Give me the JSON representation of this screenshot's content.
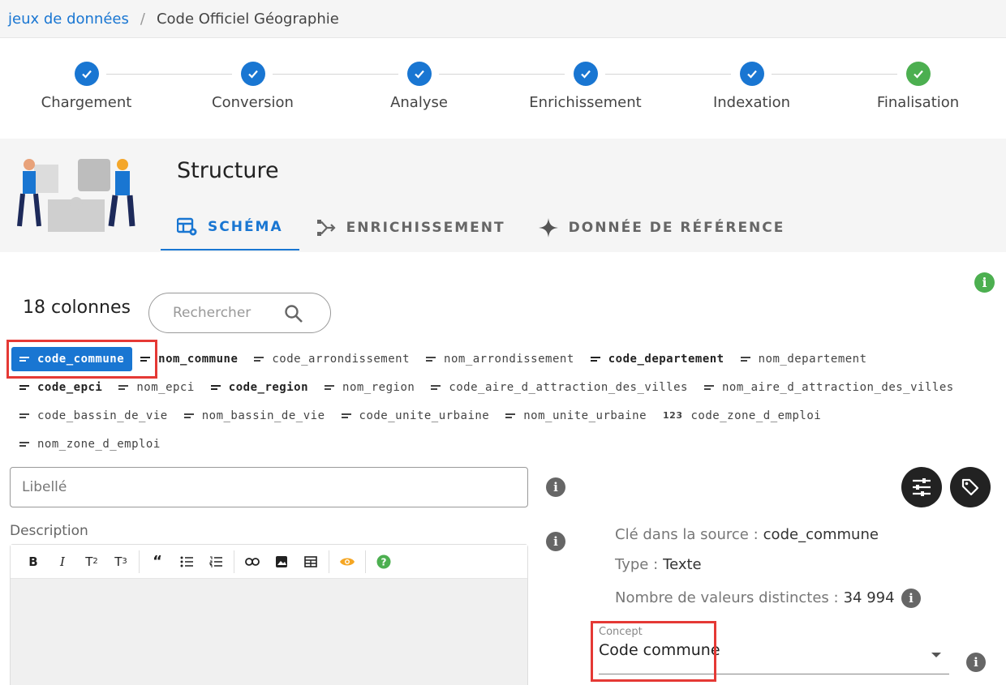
{
  "breadcrumb": {
    "root": "jeux de données",
    "separator": "/",
    "current": "Code Officiel Géographie"
  },
  "stepper": {
    "steps": [
      {
        "label": "Chargement",
        "status": "done"
      },
      {
        "label": "Conversion",
        "status": "done"
      },
      {
        "label": "Analyse",
        "status": "done"
      },
      {
        "label": "Enrichissement",
        "status": "done"
      },
      {
        "label": "Indexation",
        "status": "done"
      },
      {
        "label": "Finalisation",
        "status": "done"
      }
    ],
    "colors": {
      "done": "#1976d2",
      "final": "#4caf50"
    }
  },
  "section": {
    "title": "Structure",
    "tabs": [
      {
        "label": "SCHÉMA",
        "icon": "table-cog-icon",
        "active": true
      },
      {
        "label": "ENRICHISSEMENT",
        "icon": "merge-arrows-icon",
        "active": false
      },
      {
        "label": "DONNÉE DE RÉFÉRENCE",
        "icon": "sparkle-icon",
        "active": false
      }
    ]
  },
  "columns": {
    "count_label": "18 colonnes",
    "search_placeholder": "Rechercher",
    "rows": [
      [
        {
          "name": "code_commune",
          "icon": "text",
          "bold": true,
          "selected": true
        },
        {
          "name": "nom_commune",
          "icon": "text",
          "bold": true
        },
        {
          "name": "code_arrondissement",
          "icon": "text"
        },
        {
          "name": "nom_arrondissement",
          "icon": "text"
        },
        {
          "name": "code_departement",
          "icon": "text",
          "bold": true
        },
        {
          "name": "nom_departement",
          "icon": "text"
        }
      ],
      [
        {
          "name": "code_epci",
          "icon": "text",
          "bold": true
        },
        {
          "name": "nom_epci",
          "icon": "text"
        },
        {
          "name": "code_region",
          "icon": "text",
          "bold": true
        },
        {
          "name": "nom_region",
          "icon": "text"
        },
        {
          "name": "code_aire_d_attraction_des_villes",
          "icon": "text"
        },
        {
          "name": "nom_aire_d_attraction_des_villes",
          "icon": "text"
        }
      ],
      [
        {
          "name": "code_bassin_de_vie",
          "icon": "text"
        },
        {
          "name": "nom_bassin_de_vie",
          "icon": "text"
        },
        {
          "name": "code_unite_urbaine",
          "icon": "text"
        },
        {
          "name": "nom_unite_urbaine",
          "icon": "text"
        },
        {
          "name": "code_zone_d_emploi",
          "icon": "number"
        }
      ],
      [
        {
          "name": "nom_zone_d_emploi",
          "icon": "text"
        }
      ]
    ],
    "number_icon_text": "123"
  },
  "form": {
    "libelle_placeholder": "Libellé",
    "description_label": "Description",
    "info_glyph": "i"
  },
  "editor": {
    "toolbar": [
      "B",
      "I",
      "T2",
      "T3",
      "quote",
      "bullet-list",
      "numbered-list",
      "link",
      "image",
      "table",
      "preview",
      "help"
    ]
  },
  "details": {
    "source_key_label": "Clé dans la source :",
    "source_key_value": "code_commune",
    "type_label": "Type :",
    "type_value": "Texte",
    "distinct_label": "Nombre de valeurs distinctes :",
    "distinct_value": "34 994",
    "concept_label": "Concept",
    "concept_value": "Code commune"
  }
}
